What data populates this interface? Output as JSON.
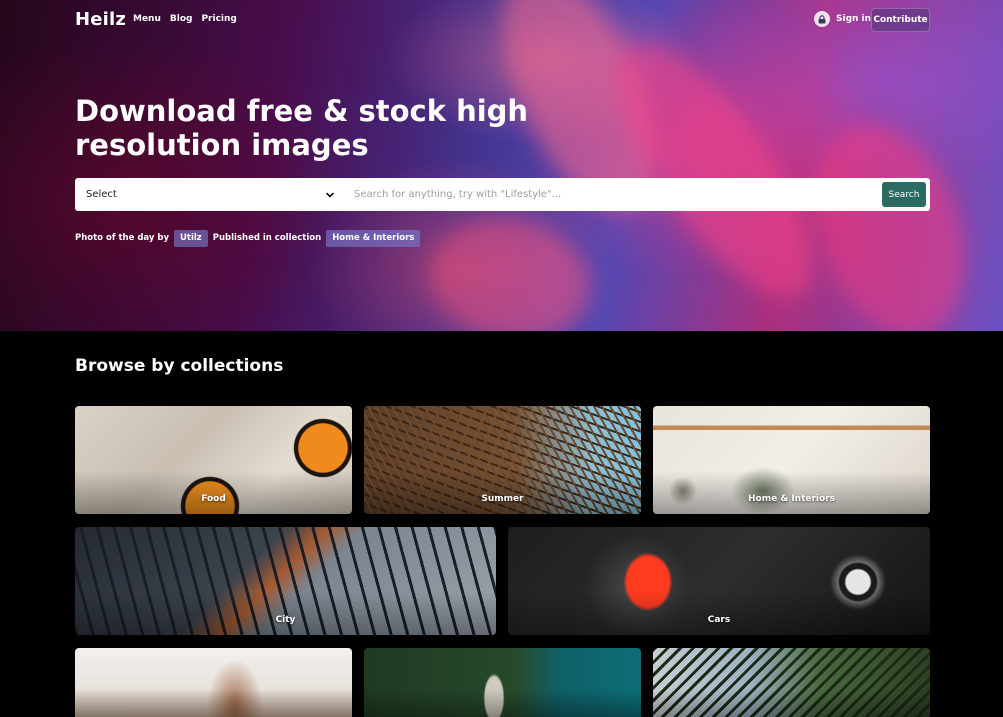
{
  "nav": {
    "brand": "Heilz",
    "links": [
      "Menu",
      "Blog",
      "Pricing"
    ],
    "sign_in": "Sign in",
    "contribute": "Contribute"
  },
  "hero": {
    "headline": "Download free & stock high resolution images",
    "search": {
      "select_value": "Select",
      "placeholder": "Search for anything, try with \"Lifestyle\"...",
      "button": "Search"
    },
    "photo_of_day": {
      "prefix": "Photo of the day by",
      "author": "Utilz",
      "middle": "Published in collection",
      "collection": "Home & Interiors"
    }
  },
  "collections": {
    "title": "Browse by collections",
    "items": [
      {
        "label": "Food"
      },
      {
        "label": "Summer"
      },
      {
        "label": "Home & Interiors"
      },
      {
        "label": "City"
      },
      {
        "label": "Cars"
      },
      {
        "label": ""
      },
      {
        "label": ""
      },
      {
        "label": ""
      }
    ]
  },
  "colors": {
    "accent": "#2c6b64",
    "chip": "#7878c8",
    "page_bg": "#000000"
  }
}
